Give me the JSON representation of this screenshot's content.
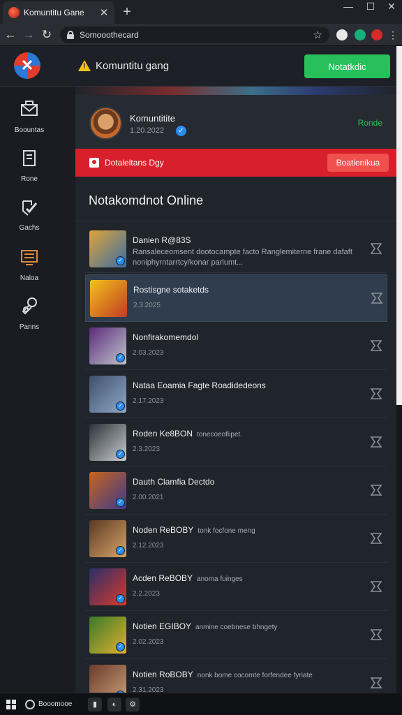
{
  "browser": {
    "tab_title": "Komuntitu Gane",
    "tab_close": "✕",
    "new_tab": "+",
    "window_controls": [
      "—",
      "☐",
      "✕"
    ],
    "url": "Somooothecard",
    "nav": [
      "←",
      "→",
      "↻"
    ],
    "star": "☆",
    "extension_colors": [
      "#e8e8e8",
      "#16b07b",
      "#d62b2b"
    ]
  },
  "header": {
    "title": "Komuntitu gang",
    "action_button": "Notatkdic",
    "accent_color": "#27c05a"
  },
  "sidebar": {
    "items": [
      {
        "label": "Boountas",
        "icon": "envelope-icon"
      },
      {
        "label": "Rone",
        "icon": "document-icon"
      },
      {
        "label": "Gachs",
        "icon": "shield-check-icon"
      },
      {
        "label": "Naloa",
        "icon": "monitor-icon"
      },
      {
        "label": "Panns",
        "icon": "wrench-icon"
      }
    ]
  },
  "profile": {
    "name": "Komuntitite",
    "meta": "1.20.2022",
    "link": "Ronde"
  },
  "alert": {
    "text": "Dotaleltans Dgy",
    "button": "Boatienikua",
    "color": "#d8202c"
  },
  "section_title": "Notakomdnot Online",
  "list": [
    {
      "title": "Danien R@83S",
      "desc": "Ransaleceomsent dootocampte facto Ranglemiterne frane dafaft noniphyrntarrtcy/konar parlumt...",
      "date": "",
      "colors": [
        "#e0a53a",
        "#3b6ea3"
      ],
      "inline": ""
    },
    {
      "title": "Rostisgne sotaketds",
      "desc": "",
      "date": "2.3.2025",
      "colors": [
        "#f2c21b",
        "#c23d22"
      ],
      "inline": ""
    },
    {
      "title": "Nonfirakomemdol",
      "desc": "",
      "date": "2.03.2023",
      "colors": [
        "#5b2a7a",
        "#bfc5cc"
      ],
      "inline": ""
    },
    {
      "title": "Nataa Eoamia Fagte Roadidedeons",
      "desc": "",
      "date": "2.17.2023",
      "colors": [
        "#3f4f6b",
        "#8ea8c6"
      ],
      "inline": ""
    },
    {
      "title": "Roden Ke8BON",
      "desc": "",
      "date": "2.3.2023",
      "colors": [
        "#2c3238",
        "#c9cdd2"
      ],
      "inline": "tonecoeofiipet."
    },
    {
      "title": "Dauth Clamfia Dectdo",
      "desc": "",
      "date": "2.00.2021",
      "colors": [
        "#c8651e",
        "#3d3a8a"
      ],
      "inline": ""
    },
    {
      "title": "Noden ReBOBY",
      "desc": "",
      "date": "2.12.2023",
      "colors": [
        "#5a3a22",
        "#d8a46a"
      ],
      "inline": "tonk focfone meng"
    },
    {
      "title": "Acden ReBOBY",
      "desc": "",
      "date": "2.2.2023",
      "colors": [
        "#2a2f6a",
        "#d83a2a"
      ],
      "inline": "anoma fuinges"
    },
    {
      "title": "Notien EGIBOY",
      "desc": "",
      "date": "2.02.2023",
      "colors": [
        "#3a7a2a",
        "#e0b030"
      ],
      "inline": "anmine coebnese bhngety"
    },
    {
      "title": "Notien RoBOBY",
      "desc": "",
      "date": "2.31.2023",
      "colors": [
        "#6a3a2a",
        "#c9a07a"
      ],
      "inline": "nonk bome cocomte forfendee fyriate"
    }
  ],
  "taskbar": {
    "label": "Booomooe",
    "apps": [
      "▮",
      "◐",
      "⚙"
    ]
  }
}
